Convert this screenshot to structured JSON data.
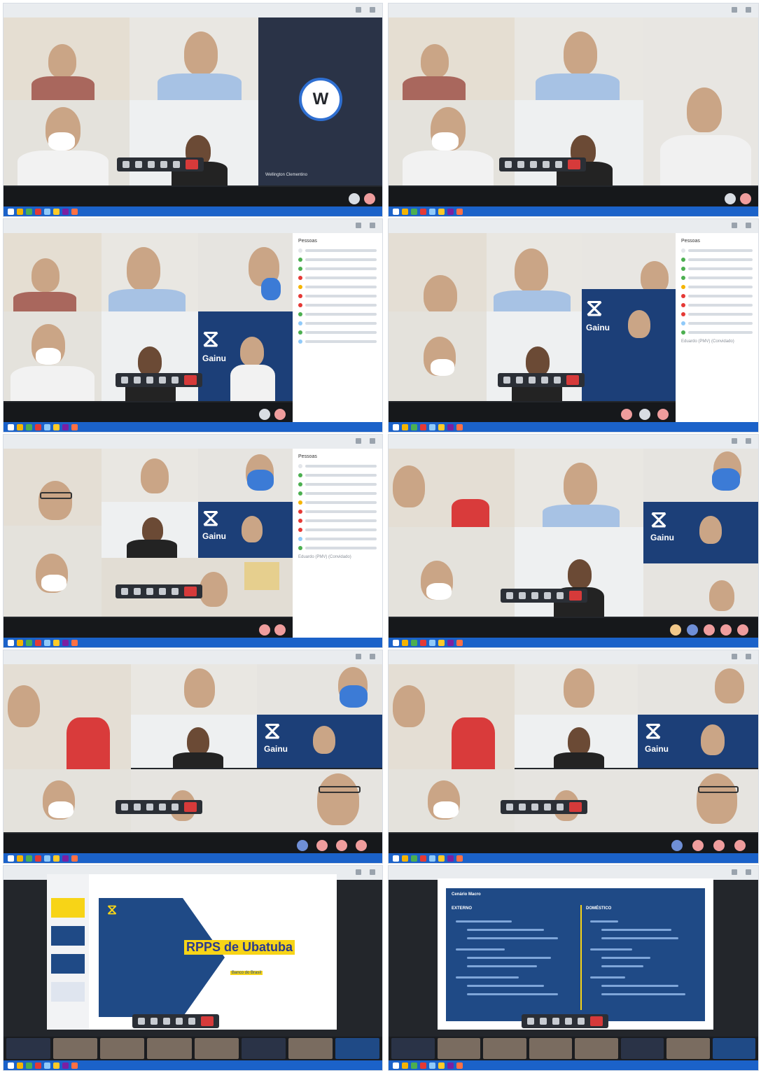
{
  "panels": [
    {
      "id": "p1",
      "participant_letter": "W",
      "participant_name": "Wellington Clementino"
    },
    {
      "id": "p2"
    },
    {
      "id": "p3",
      "people_title": "Pessoas"
    },
    {
      "id": "p4",
      "people_title": "Pessoas",
      "entry": "Eduardo (PMV) (Convidado)"
    },
    {
      "id": "p5",
      "people_title": "Pessoas",
      "entry": "Eduardo (PMV) (Convidado)"
    },
    {
      "id": "p6"
    },
    {
      "id": "p7"
    },
    {
      "id": "p8"
    },
    {
      "id": "p9",
      "slide_title": "RPPS de Ubatuba",
      "slide_subtitle": "Banco do Brasil"
    },
    {
      "id": "p10",
      "slide_header": "Cenário Macro",
      "col_left": "EXTERNO",
      "col_right": "DOMÉSTICO"
    }
  ],
  "brand": {
    "bb_logo": "Gainu",
    "accent": "#1c3f78",
    "hang_color": "#d63a3a",
    "taskbar_color": "#1b62c9"
  }
}
